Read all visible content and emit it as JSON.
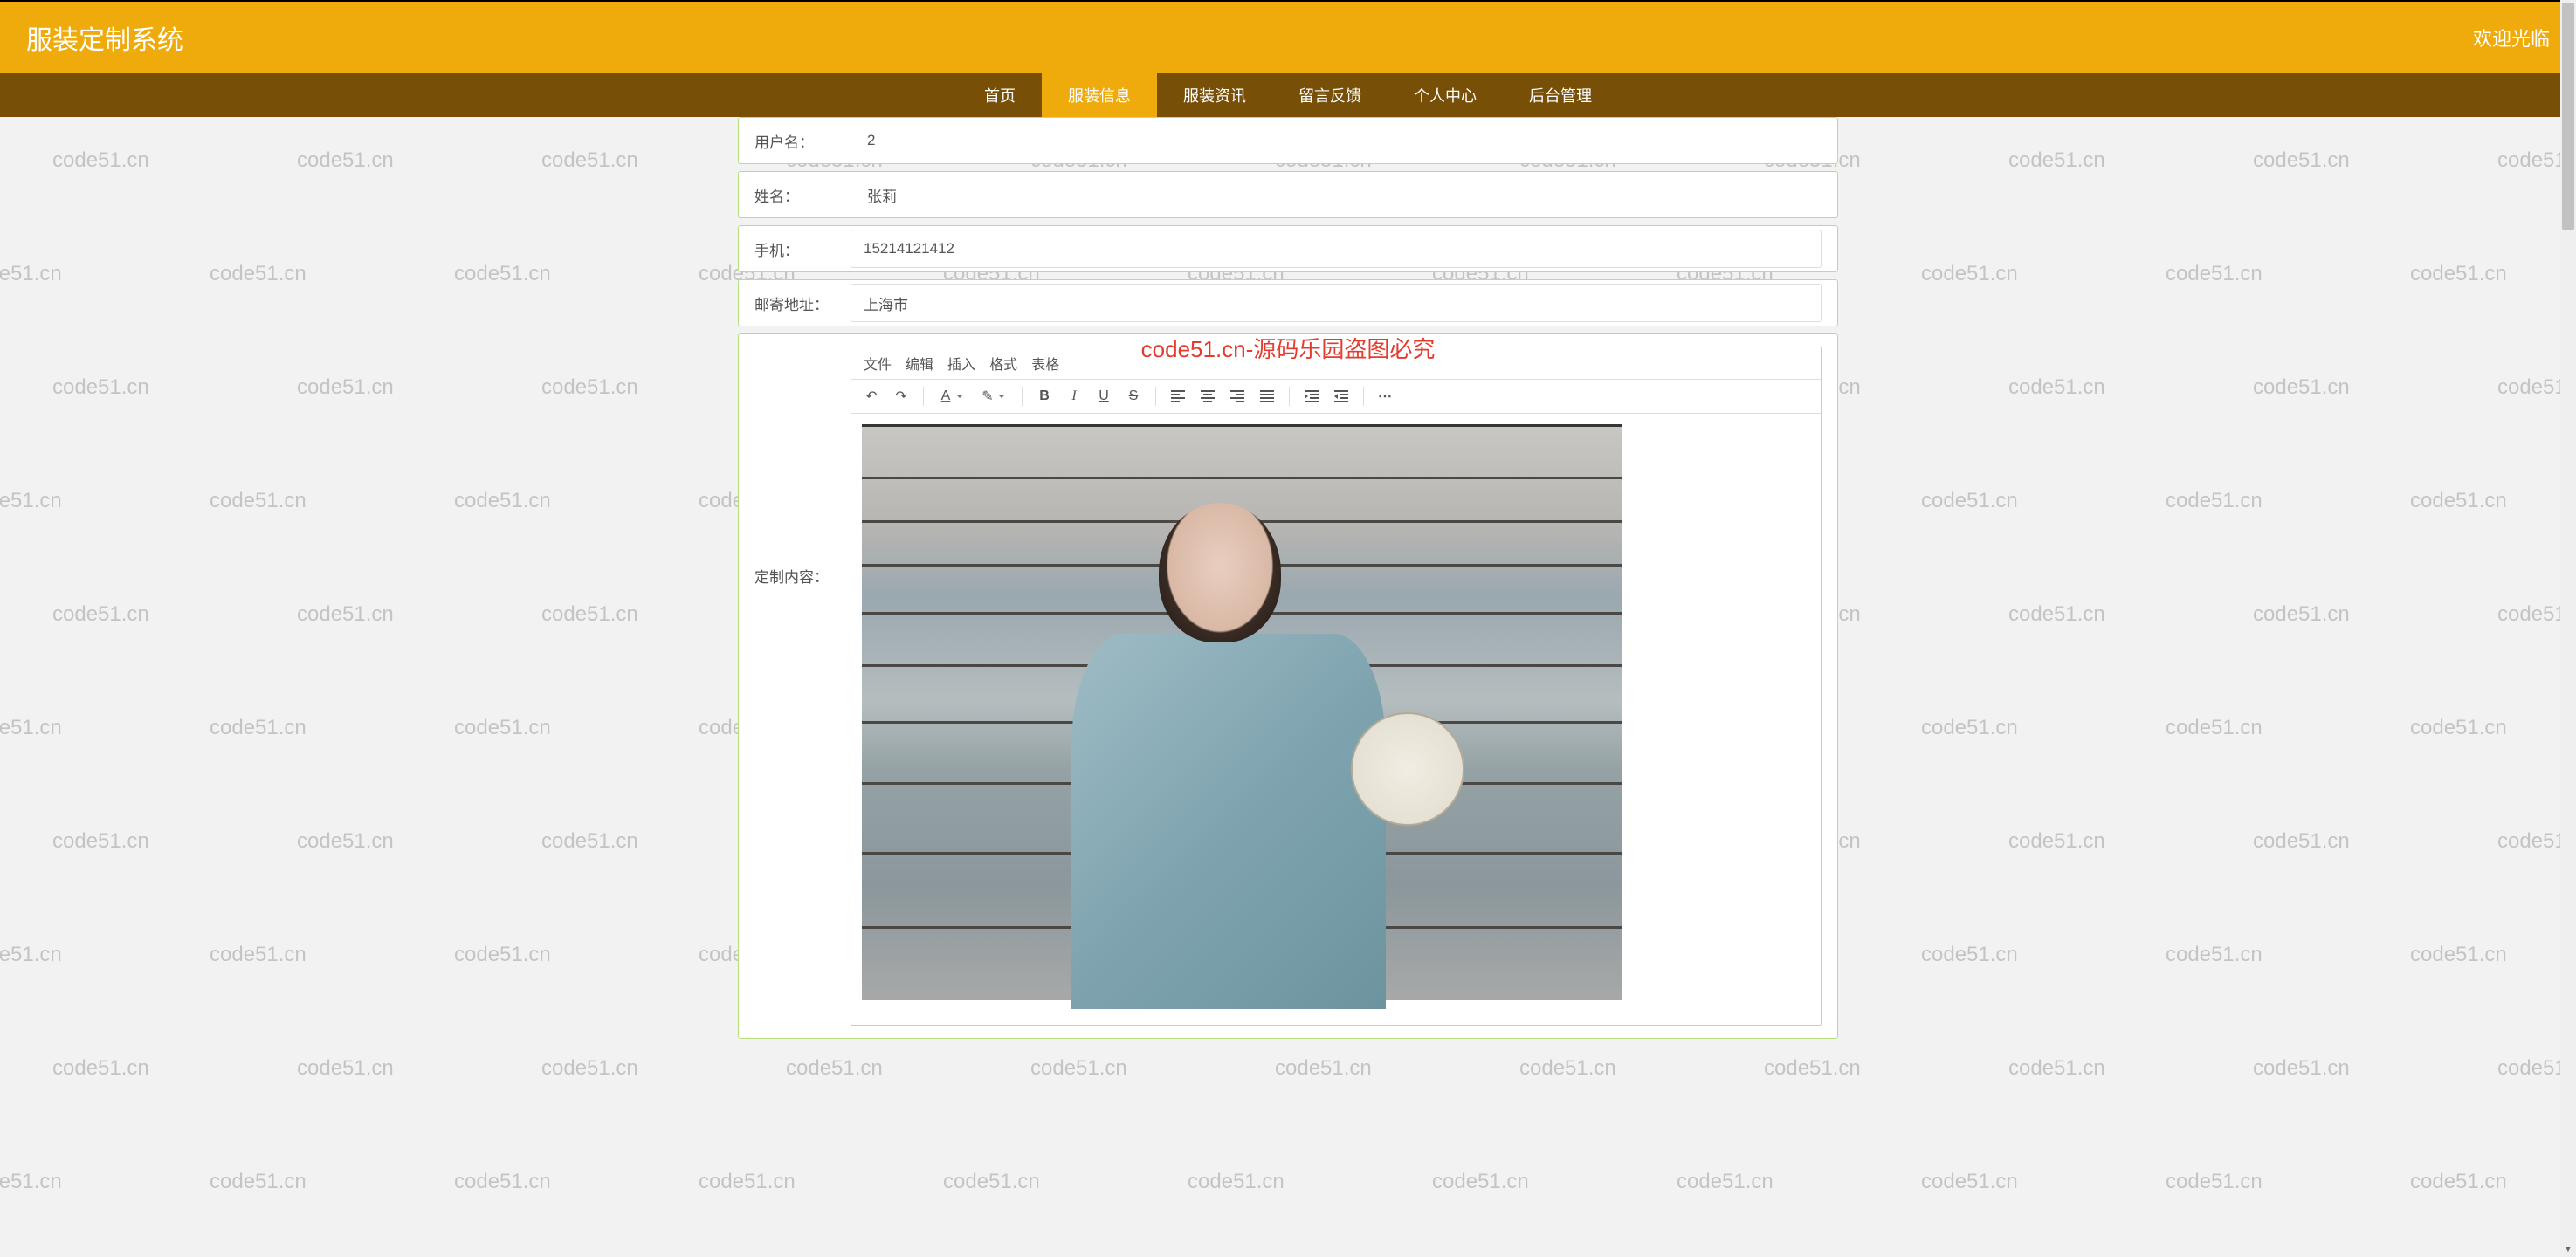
{
  "header": {
    "title": "服装定制系统",
    "welcome": "欢迎光临"
  },
  "nav": {
    "items": [
      {
        "label": "首页"
      },
      {
        "label": "服装信息",
        "active": true
      },
      {
        "label": "服装资讯"
      },
      {
        "label": "留言反馈"
      },
      {
        "label": "个人中心"
      },
      {
        "label": "后台管理"
      }
    ]
  },
  "form": {
    "username_label": "用户名：",
    "username_value": "2",
    "name_label": "姓名：",
    "name_value": "张莉",
    "phone_label": "手机：",
    "phone_value": "15214121412",
    "address_label": "邮寄地址：",
    "address_value": "上海市",
    "content_label": "定制内容："
  },
  "editor": {
    "menus": [
      "文件",
      "编辑",
      "插入",
      "格式",
      "表格"
    ],
    "toolbar_icons": {
      "undo": "↶",
      "redo": "↷",
      "textcolor": "A",
      "highlight": "✎",
      "bold": "B",
      "italic": "I",
      "underline": "U",
      "strike": "S",
      "align_left": "≡",
      "align_center": "≡",
      "align_right": "≡",
      "align_justify": "≡",
      "outdent": "⇤",
      "indent": "⇥",
      "more": "⋯"
    }
  },
  "watermark": {
    "text": "code51.cn",
    "center": "code51.cn-源码乐园盗图必究"
  }
}
